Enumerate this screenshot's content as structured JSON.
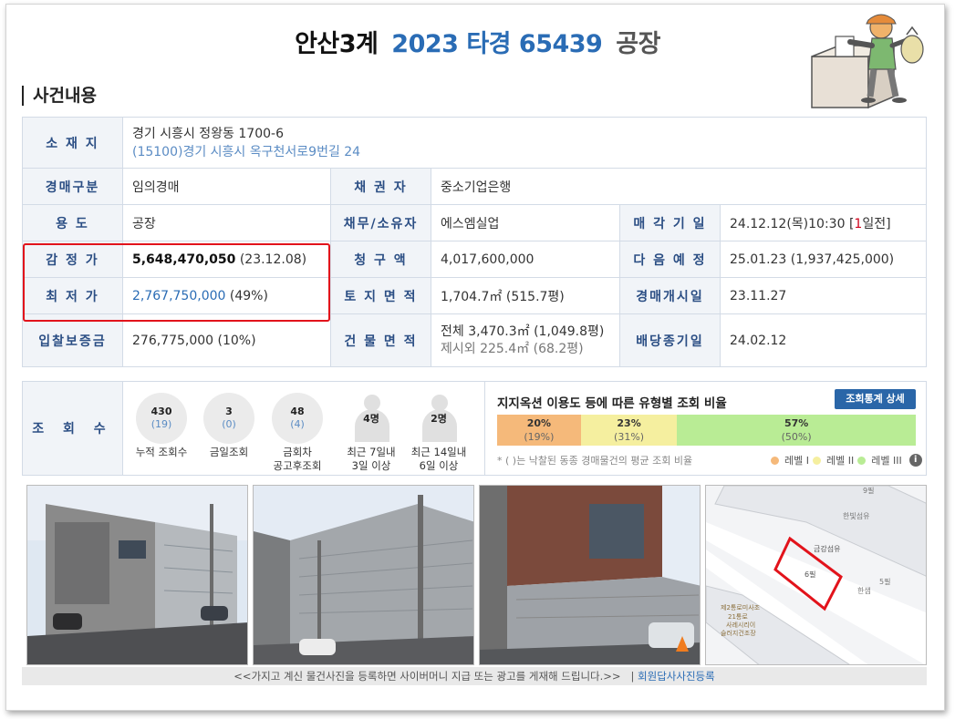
{
  "title": {
    "court": "안산3계",
    "case": "2023 타경 65439",
    "kind": "공장"
  },
  "section": {
    "heading": "사건내용"
  },
  "info": {
    "location_label": "소 재 지",
    "address_lot": "경기 시흥시 정왕동 1700-6",
    "address_road": "(15100)경기 시흥시  옥구천서로9번길  24",
    "auction_type_label": "경매구분",
    "auction_type": "임의경매",
    "creditor_label": "채 권 자",
    "creditor": "중소기업은행",
    "usage_label": "용      도",
    "usage": "공장",
    "debtor_label": "채무/소유자",
    "debtor": "에스엠실업",
    "dismissal_date_label": "매 각 기 일",
    "dismissal_date_prefix": "24.12.12(목)10:30 [",
    "dismissal_date_count": "1",
    "dismissal_date_suffix": "일전]",
    "appraisal_label": "감 정 가",
    "appraisal_value": "5,648,470,050",
    "appraisal_date": "(23.12.08)",
    "claim_label": "청 구 액",
    "claim_value": "4,017,600,000",
    "next_schedule_label": "다 음 예 정",
    "next_schedule": "25.01.23 (1,937,425,000)",
    "minimum_label": "최 저 가",
    "minimum_value": "2,767,750,000",
    "minimum_pct": "(49%)",
    "land_area_label": "토 지 면 적",
    "land_area": "1,704.7㎡ (515.7평)",
    "auction_start_label": "경매개시일",
    "auction_start": "23.11.27",
    "deposit_label": "입찰보증금",
    "deposit": "276,775,000 (10%)",
    "building_area_label": "건 물 면 적",
    "building_area_total": "전체 3,470.3㎡ (1,049.8평)",
    "building_area_excl": "제시외 225.4㎡ (68.2평)",
    "dividend_deadline_label": "배당종기일",
    "dividend_deadline": "24.02.12"
  },
  "views": {
    "label": "조 회 수",
    "stats": [
      {
        "count": "430",
        "sub": "(19)",
        "label": "누적 조회수"
      },
      {
        "count": "3",
        "sub": "(0)",
        "label": "금일조회"
      },
      {
        "count": "48",
        "sub": "(4)",
        "label": "금회차\n공고후조회"
      }
    ],
    "people": [
      {
        "count": "4명",
        "label": "최근 7일내\n3일 이상"
      },
      {
        "count": "2명",
        "label": "최근 14일내\n6일 이상"
      }
    ],
    "ratio_title": "지지옥션 이용도 등에 따른 유형별 조회 비율",
    "ratio_button": "조회통계 상세",
    "ratio_segments": [
      {
        "pct": "20%",
        "avg": "(19%)",
        "color": "#f5b97a",
        "value": 20
      },
      {
        "pct": "23%",
        "avg": "(31%)",
        "color": "#f5ef9f",
        "value": 23
      },
      {
        "pct": "57%",
        "avg": "(50%)",
        "color": "#b9ec95",
        "value": 57
      }
    ],
    "note": "* ( )는 낙찰된 동종 경매물건의 평균 조회 비율",
    "legend": [
      {
        "label": "레벨 I",
        "color": "#f5b97a"
      },
      {
        "label": "레벨 II",
        "color": "#f5ef9f"
      },
      {
        "label": "레벨 III",
        "color": "#b9ec95"
      }
    ],
    "info_icon": "i"
  },
  "map_labels": {
    "a": "9필",
    "b": "한빛섬유",
    "c": "금강섬유",
    "d": "6필",
    "e": "5필",
    "f": "한샘",
    "g": "제2통로미사조",
    "h": "21통로",
    "i": "사레시리이",
    "j": "슬러지건조장"
  },
  "footer": {
    "notice": "<<가지고 계신 물건사진을 등록하면 사이버머니 지급 또는 광고를 게재해 드립니다.>>",
    "separator": "|",
    "link": "회원답사사진등록"
  }
}
